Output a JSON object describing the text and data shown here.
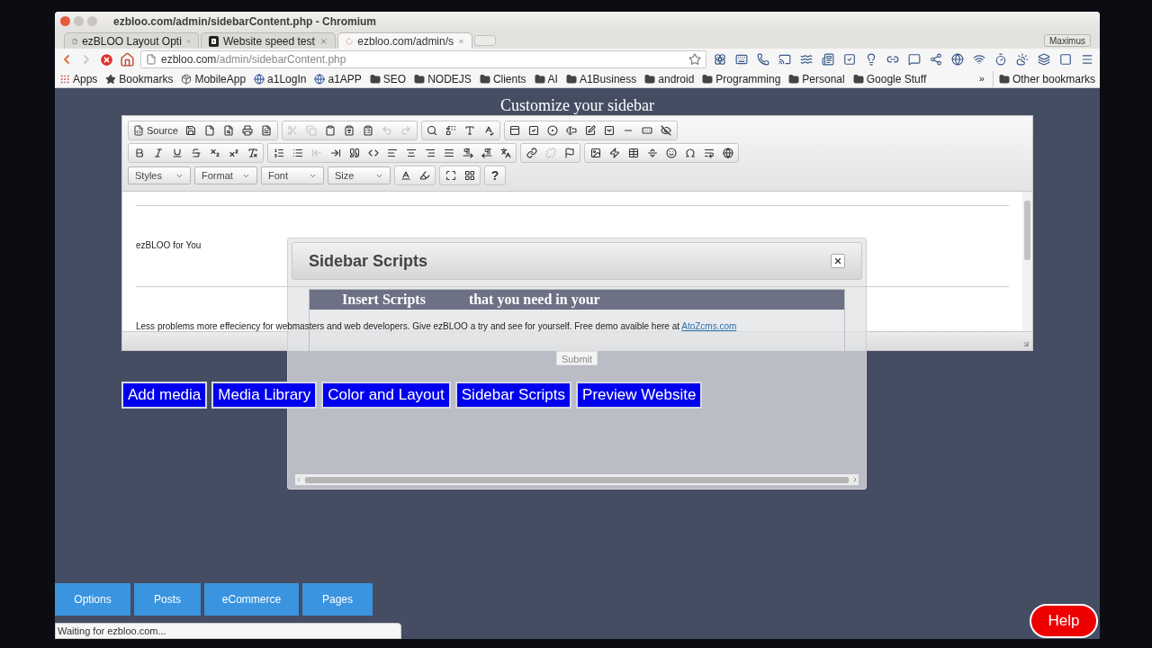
{
  "window": {
    "title": "ezbloo.com/admin/sidebarContent.php - Chromium"
  },
  "tabs": [
    {
      "kind": "page",
      "title": "ezBLOO Layout Opti",
      "selected": false
    },
    {
      "kind": "logo",
      "title": "Website speed test",
      "selected": false
    },
    {
      "kind": "loading",
      "title": "ezbloo.com/admin/s",
      "selected": true
    }
  ],
  "profile": "Maximus",
  "address": {
    "host": "ezbloo.com",
    "path": "/admin/sidebarContent.php"
  },
  "bookmarks": [
    {
      "kind": "apps",
      "label": "Apps"
    },
    {
      "kind": "star",
      "label": "Bookmarks"
    },
    {
      "kind": "app",
      "label": "MobileApp"
    },
    {
      "kind": "globe",
      "label": "a1LogIn"
    },
    {
      "kind": "globe",
      "label": "a1APP"
    },
    {
      "kind": "folder",
      "label": "SEO"
    },
    {
      "kind": "folder",
      "label": "NODEJS"
    },
    {
      "kind": "folder",
      "label": "Clients"
    },
    {
      "kind": "folder",
      "label": "AI"
    },
    {
      "kind": "folder",
      "label": "A1Business"
    },
    {
      "kind": "folder",
      "label": "android"
    },
    {
      "kind": "folder",
      "label": "Programming"
    },
    {
      "kind": "folder",
      "label": "Personal"
    },
    {
      "kind": "folder",
      "label": "Google Stuff"
    }
  ],
  "bookmarks_more": "»",
  "other_bookmarks": "Other bookmarks",
  "heading": "Customize your sidebar",
  "editor": {
    "toolbar": [
      [
        [
          {
            "kind": "source",
            "label": "Source",
            "disabled": false
          },
          {
            "kind": "save",
            "disabled": false
          },
          {
            "kind": "newpage",
            "disabled": false
          },
          {
            "kind": "preview",
            "disabled": false
          },
          {
            "kind": "print",
            "disabled": false
          },
          {
            "kind": "templates",
            "disabled": false
          }
        ],
        [
          {
            "kind": "cut",
            "disabled": true
          },
          {
            "kind": "copy",
            "disabled": true
          },
          {
            "kind": "paste",
            "disabled": false
          },
          {
            "kind": "pastetext",
            "disabled": false
          },
          {
            "kind": "pasteword",
            "disabled": false
          },
          {
            "kind": "undo",
            "disabled": true
          },
          {
            "kind": "redo",
            "disabled": true
          }
        ],
        [
          {
            "kind": "find",
            "disabled": false
          },
          {
            "kind": "replace",
            "disabled": false
          },
          {
            "kind": "selectall",
            "disabled": false
          },
          {
            "kind": "spellcheck",
            "disabled": false
          }
        ],
        [
          {
            "kind": "form",
            "disabled": false
          },
          {
            "kind": "checkbox",
            "disabled": false
          },
          {
            "kind": "radio",
            "disabled": false
          },
          {
            "kind": "textfield",
            "disabled": false
          },
          {
            "kind": "textarea",
            "disabled": false
          },
          {
            "kind": "select",
            "disabled": false
          },
          {
            "kind": "button",
            "disabled": false
          },
          {
            "kind": "imagebutton",
            "disabled": false
          },
          {
            "kind": "hiddenfield",
            "disabled": false
          }
        ]
      ],
      [
        [
          {
            "kind": "bold",
            "disabled": false
          },
          {
            "kind": "italic",
            "disabled": false
          },
          {
            "kind": "underline",
            "disabled": false
          },
          {
            "kind": "strike",
            "disabled": false
          },
          {
            "kind": "subscript",
            "disabled": false
          },
          {
            "kind": "superscript",
            "disabled": false
          },
          {
            "kind": "removeformat",
            "disabled": false
          }
        ],
        [
          {
            "kind": "numlist",
            "disabled": false
          },
          {
            "kind": "bulletlist",
            "disabled": false
          },
          {
            "kind": "outdent",
            "disabled": true
          },
          {
            "kind": "indent",
            "disabled": false
          },
          {
            "kind": "blockquote",
            "disabled": false
          },
          {
            "kind": "creatediv",
            "disabled": false
          },
          {
            "kind": "alignleft",
            "disabled": false
          },
          {
            "kind": "aligncenter",
            "disabled": false
          },
          {
            "kind": "alignright",
            "disabled": false
          },
          {
            "kind": "justify",
            "disabled": false
          },
          {
            "kind": "ltr",
            "disabled": false
          },
          {
            "kind": "rtl",
            "disabled": false
          },
          {
            "kind": "language",
            "disabled": false
          }
        ],
        [
          {
            "kind": "link",
            "disabled": false
          },
          {
            "kind": "unlink",
            "disabled": true
          },
          {
            "kind": "anchor",
            "disabled": false
          }
        ],
        [
          {
            "kind": "image",
            "disabled": false
          },
          {
            "kind": "flash",
            "disabled": false
          },
          {
            "kind": "table",
            "disabled": false
          },
          {
            "kind": "hr",
            "disabled": false
          },
          {
            "kind": "smiley",
            "disabled": false
          },
          {
            "kind": "specialchar",
            "disabled": false
          },
          {
            "kind": "pagebreak",
            "disabled": false
          },
          {
            "kind": "iframe",
            "disabled": false
          }
        ]
      ],
      [
        [
          {
            "kind": "combo",
            "label": "Styles",
            "disabled": false
          }
        ],
        [
          {
            "kind": "combo",
            "label": "Format",
            "disabled": false
          }
        ],
        [
          {
            "kind": "combo",
            "label": "Font",
            "disabled": false
          }
        ],
        [
          {
            "kind": "combo",
            "label": "Size",
            "disabled": false
          }
        ],
        [
          {
            "kind": "textcolor",
            "disabled": false
          },
          {
            "kind": "bgcolor",
            "disabled": false
          }
        ],
        [
          {
            "kind": "maximize",
            "disabled": false
          },
          {
            "kind": "showblocks",
            "disabled": false
          }
        ],
        [
          {
            "kind": "about",
            "label": "?",
            "disabled": false
          }
        ]
      ]
    ],
    "title_line": "ezBLOO for You",
    "paragraph": "Less problems more effeciency for webmasters and web developers. Give ezBLOO a try and see for yourself. Free demo avaible here at",
    "link": "AtoZcms.com"
  },
  "buttons": [
    "Add media",
    "Media Library",
    "Color and Layout",
    "Sidebar Scripts",
    "Preview Website"
  ],
  "dialog": {
    "title": "Sidebar Scripts",
    "banner": [
      "Insert Scripts",
      "that you need in your"
    ],
    "submit": "Submit"
  },
  "nav": [
    "Options",
    "Posts",
    "eCommerce",
    "Pages"
  ],
  "status": "Waiting for ezbloo.com...",
  "help": "Help"
}
